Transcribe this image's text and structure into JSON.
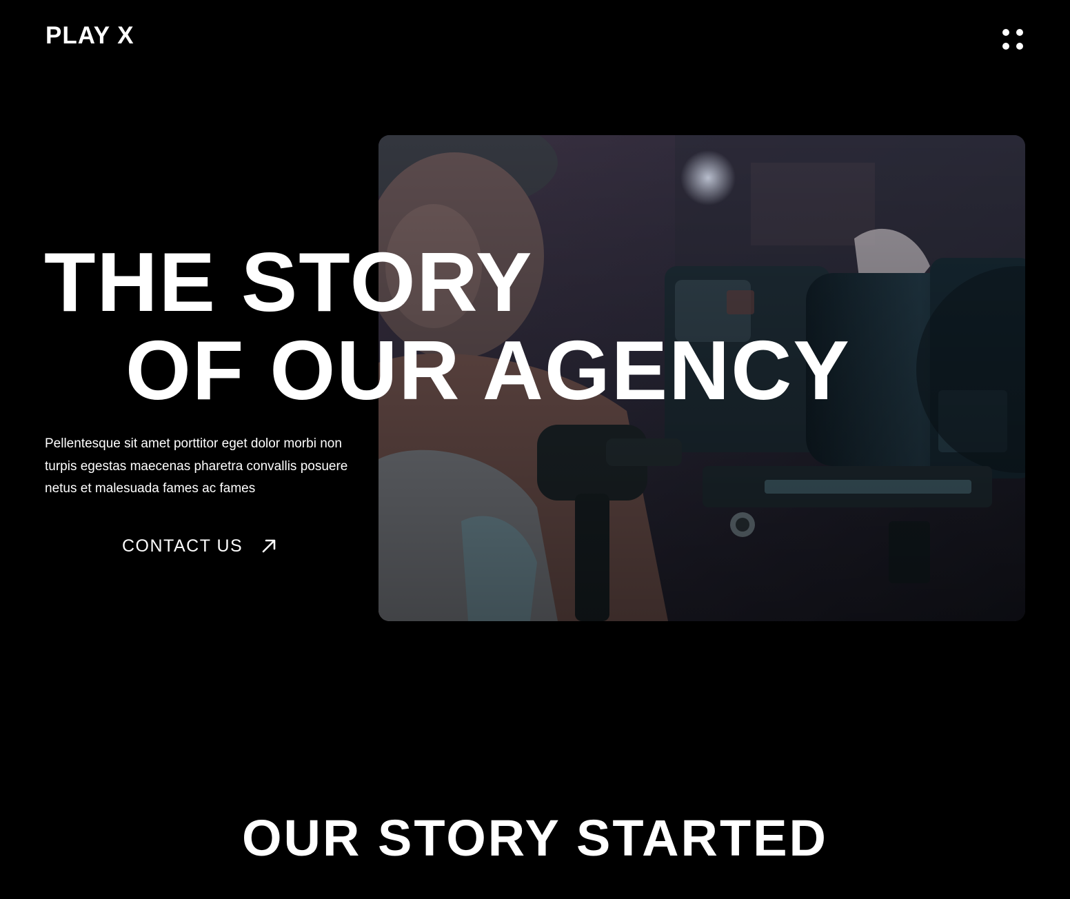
{
  "header": {
    "logo": "PLAY X",
    "menu_icon": "grid-dots-icon"
  },
  "hero": {
    "title_line1": "THE STORY",
    "title_line2": "OF OUR AGENCY",
    "description": "Pellentesque sit amet porttitor eget dolor morbi non turpis egestas maecenas pharetra convallis posuere netus et malesuada fames ac fames",
    "cta_label": "CONTACT US",
    "cta_icon": "arrow-up-right-icon",
    "image_subject": "camera operator with cinema camera"
  },
  "section": {
    "title": "OUR STORY STARTED"
  },
  "colors": {
    "background": "#000000",
    "text": "#ffffff"
  }
}
